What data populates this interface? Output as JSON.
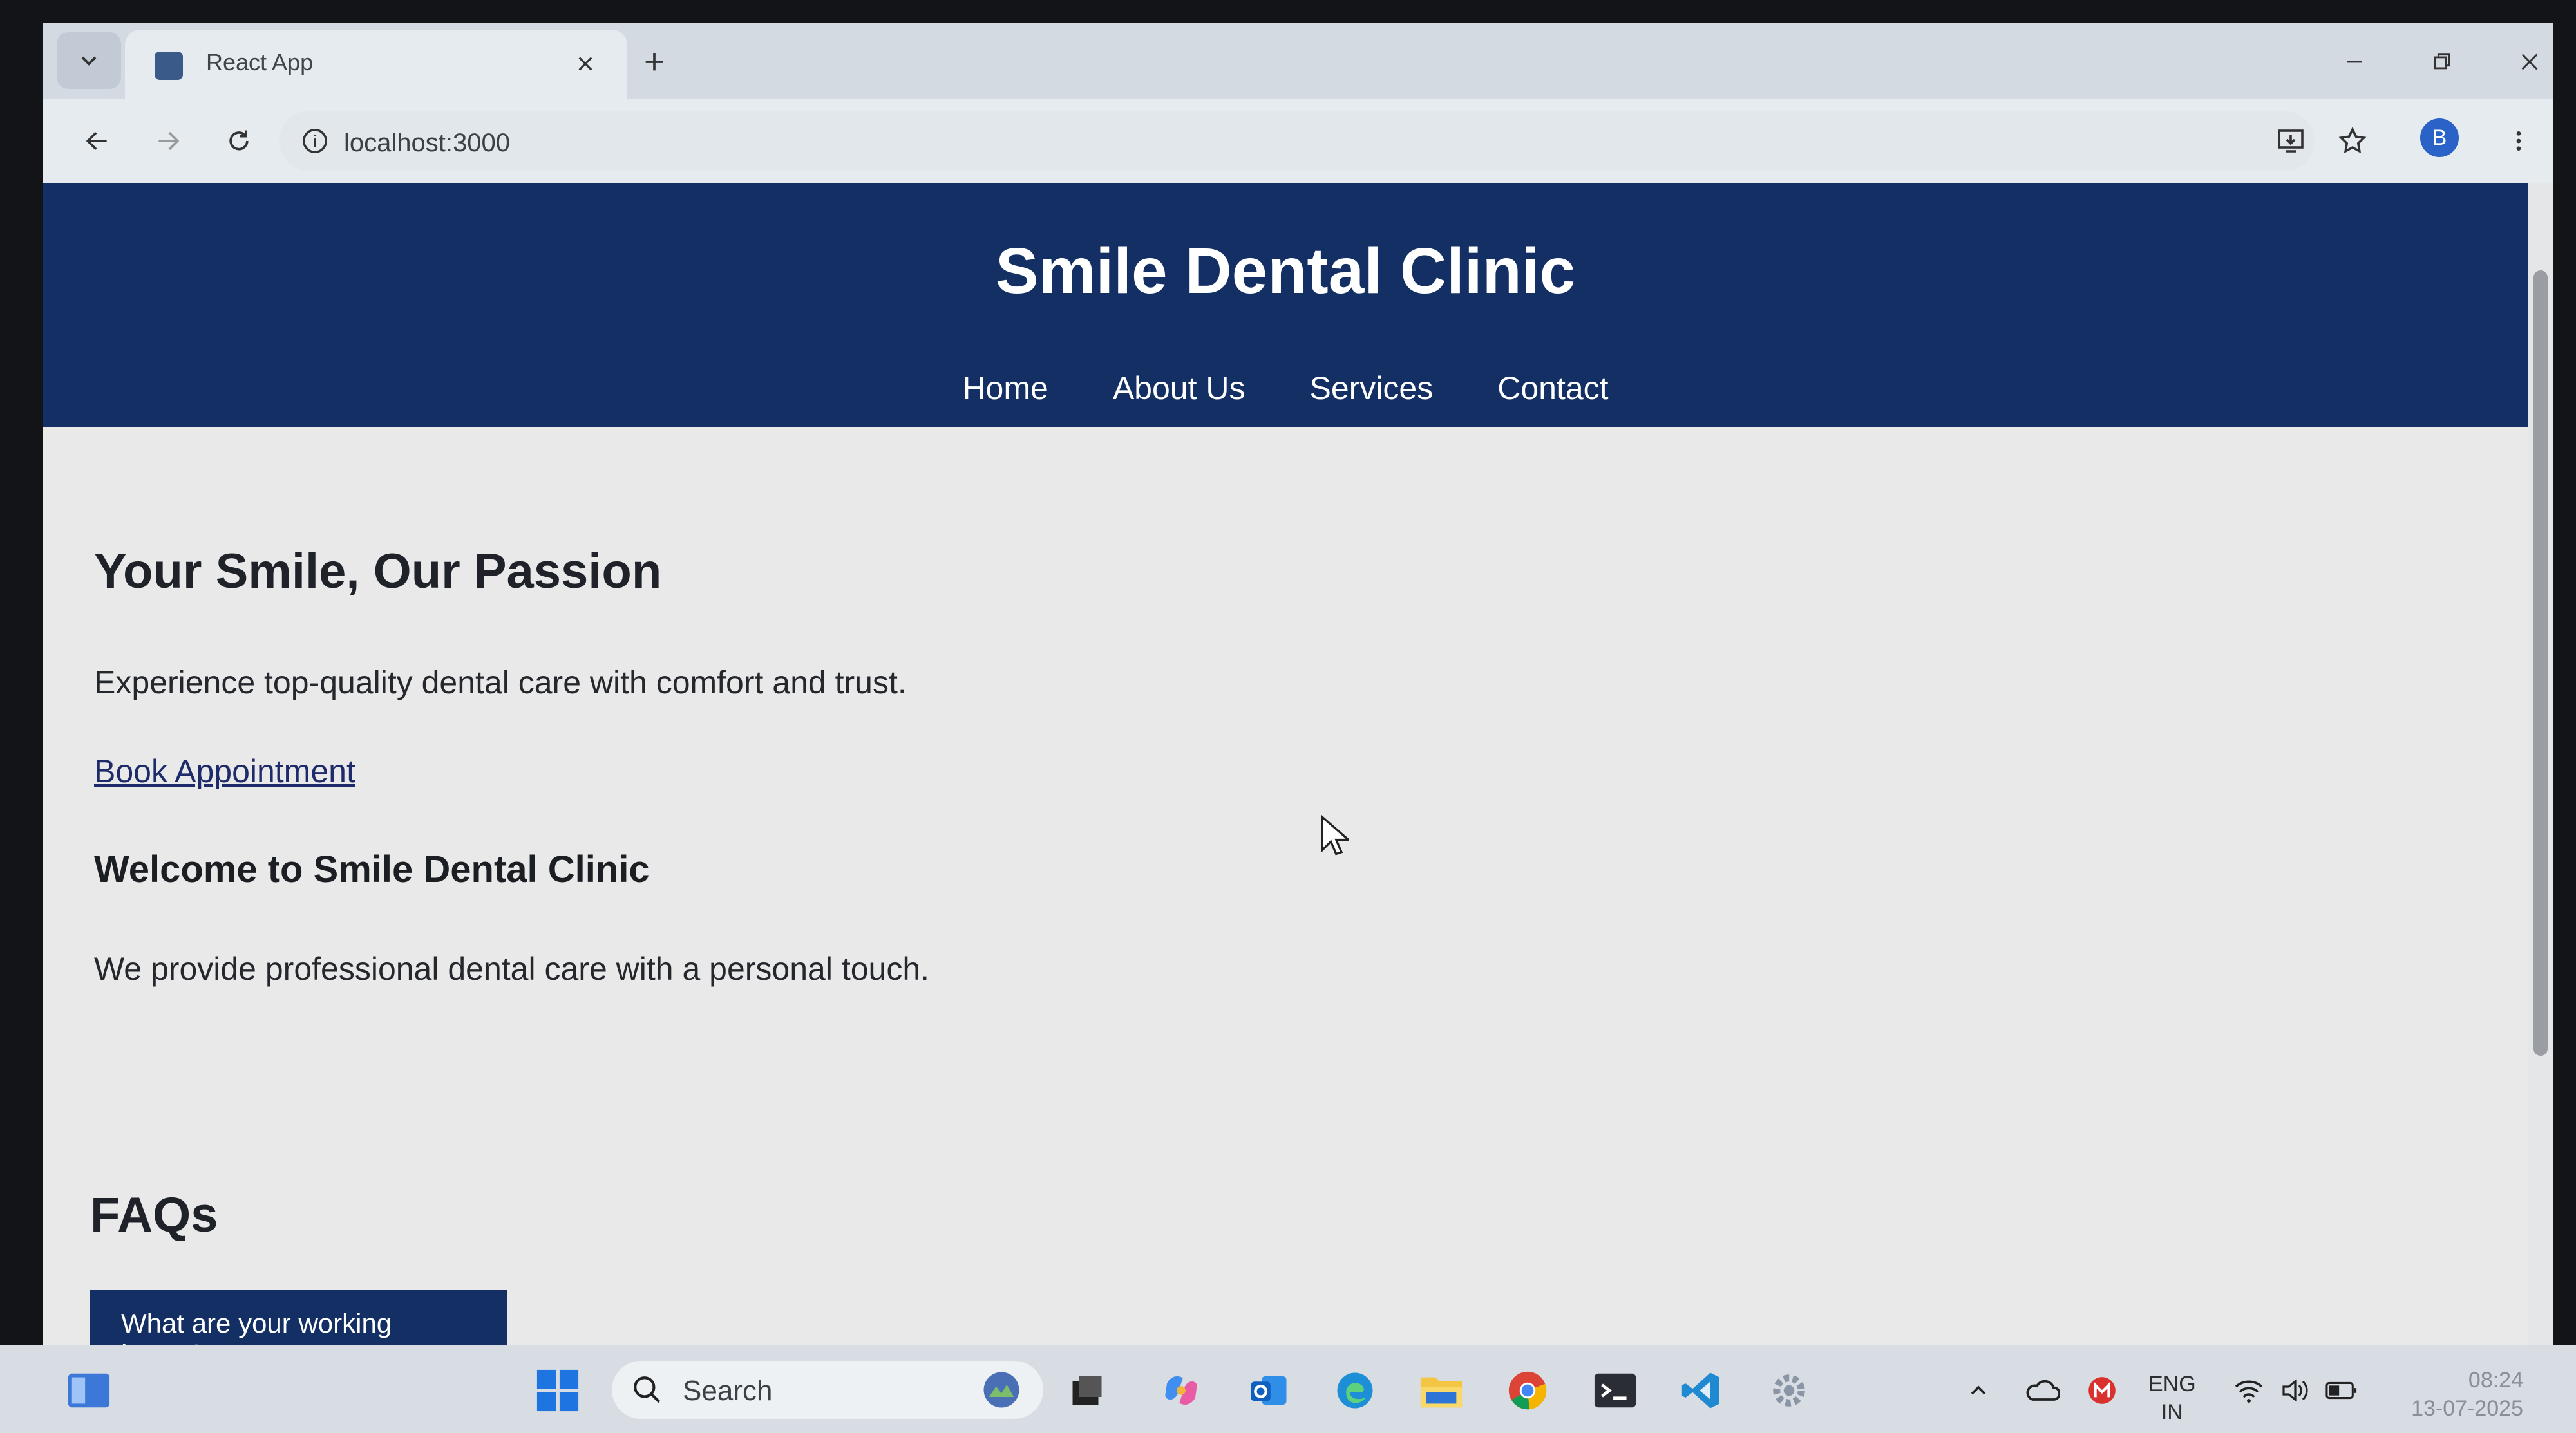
{
  "browser": {
    "tab_title": "React App",
    "url": "localhost:3000",
    "profile_initial": "B"
  },
  "site": {
    "title": "Smile Dental Clinic",
    "nav": [
      "Home",
      "About Us",
      "Services",
      "Contact"
    ],
    "hero": {
      "title": "Your Smile, Our Passion",
      "text": "Experience top-quality dental care with comfort and trust.",
      "cta": "Book Appointment"
    },
    "welcome": {
      "title": "Welcome to Smile Dental Clinic",
      "text": "We provide professional dental care with a personal touch."
    },
    "faq": {
      "title": "FAQs",
      "questions": [
        "What are your working hours?"
      ]
    }
  },
  "taskbar": {
    "search_placeholder": "Search",
    "language": "ENG",
    "region": "IN",
    "time": "08:24",
    "date": "13-07-2025"
  },
  "colors": {
    "header_bg": "#132f63",
    "page_bg": "#e9e9ea",
    "link": "#1e2b6a"
  }
}
